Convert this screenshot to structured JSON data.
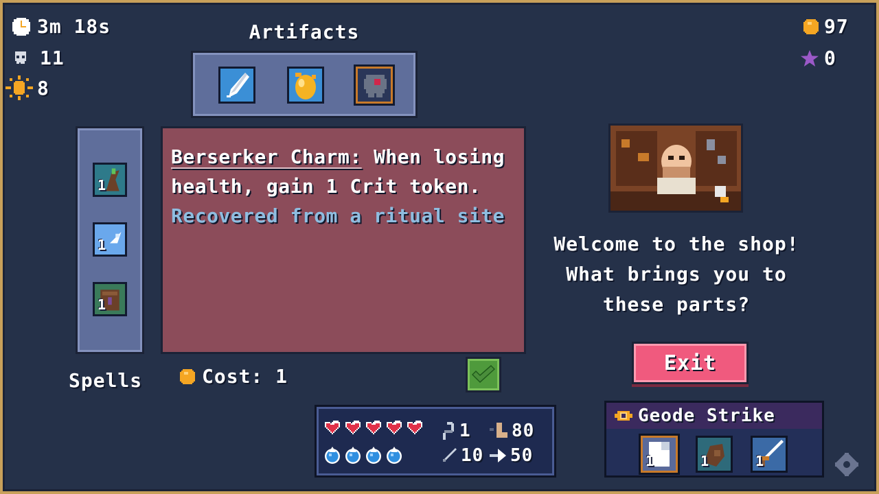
{
  "hud": {
    "time": "3m 18s",
    "kills": "11",
    "light": "8",
    "coins": "97",
    "stars": "0"
  },
  "artifacts": {
    "title": "Artifacts",
    "items": [
      {
        "icon": "feather-icon"
      },
      {
        "icon": "golden-egg-icon"
      },
      {
        "icon": "berserker-charm-icon",
        "selected": true
      }
    ]
  },
  "spells": {
    "label": "Spells",
    "items": [
      {
        "icon": "root-spell-icon",
        "level": "1"
      },
      {
        "icon": "ice-spell-icon",
        "level": "1"
      },
      {
        "icon": "tome-spell-icon",
        "level": "1"
      }
    ]
  },
  "description": {
    "name": "Berserker Charm:",
    "text": " When losing health, gain 1 Crit token.",
    "flavor": "Recovered from a ritual site"
  },
  "cost": {
    "label": "Cost: 1"
  },
  "shop": {
    "greeting_line1": "Welcome to the shop!",
    "greeting_line2": "What brings you to",
    "greeting_line3": "these parts?",
    "exit_label": "Exit"
  },
  "player": {
    "hearts": 5,
    "mana": 4,
    "stat_a": "1",
    "stat_b": "80",
    "stat_c": "10",
    "stat_d": "50"
  },
  "ability": {
    "name": "Geode Strike",
    "slots": [
      {
        "icon": "card-icon",
        "level": "1"
      },
      {
        "icon": "root-spell-icon",
        "level": "1"
      },
      {
        "icon": "sword-spell-icon",
        "level": "1"
      }
    ]
  },
  "colors": {
    "background": "#253149",
    "exit": "#f05a7e",
    "description_panel": "#8c4c5a",
    "flavor_text": "#8fbde0",
    "coin": "#f5a623"
  }
}
